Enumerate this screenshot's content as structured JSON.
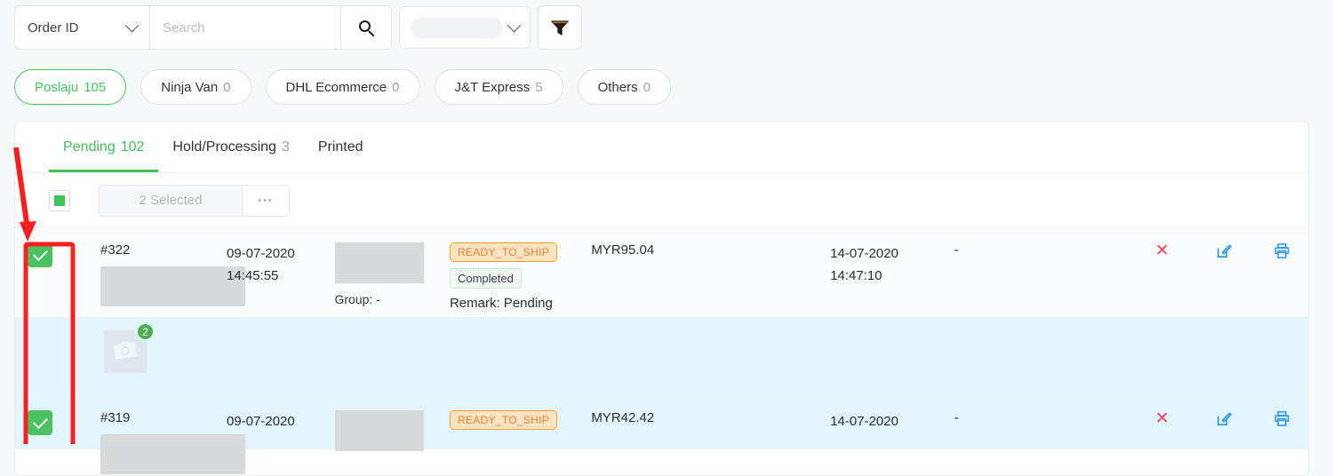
{
  "search": {
    "field_label": "Order ID",
    "placeholder": "Search",
    "value": "",
    "search_icon": "search-icon",
    "secondary_select_value": "",
    "chevron_icon": "chevron-down-icon",
    "filter_icon": "funnel-filter-icon"
  },
  "couriers": [
    {
      "label": "Poslaju",
      "count": "105",
      "active": true
    },
    {
      "label": "Ninja Van",
      "count": "0",
      "active": false
    },
    {
      "label": "DHL Ecommerce",
      "count": "0",
      "active": false
    },
    {
      "label": "J&T Express",
      "count": "5",
      "active": false
    },
    {
      "label": "Others",
      "count": "0",
      "active": false
    }
  ],
  "tabs": [
    {
      "label": "Pending",
      "count": "102",
      "active": true
    },
    {
      "label": "Hold/Processing",
      "count": "3",
      "active": false
    },
    {
      "label": "Printed",
      "count": "",
      "active": false
    }
  ],
  "toolbar": {
    "select_all_icon": "indeterminate-checkbox-icon",
    "selected_label": "2 Selected",
    "more_label": "⋯"
  },
  "rows": [
    {
      "checked": true,
      "order_id": "#322",
      "date": "09-07-2020",
      "time": "14:45:55",
      "group_label": "Group: -",
      "status_badge": "READY_TO_SHIP",
      "sub_badge": "Completed",
      "remark": "Remark: Pending",
      "amount": "MYR95.04",
      "sla_date": "14-07-2020",
      "sla_time": "14:47:10",
      "extra": "-",
      "cancel_icon": "close-x-icon",
      "edit_icon": "edit-pencil-icon",
      "print_icon": "printer-icon"
    },
    {
      "checked": true,
      "order_id": "#319",
      "date": "09-07-2020",
      "time": "",
      "group_label": "",
      "status_badge": "READY_TO_SHIP",
      "sub_badge": "",
      "remark": "",
      "amount": "MYR42.42",
      "sla_date": "14-07-2020",
      "sla_time": "",
      "extra": "-",
      "cancel_icon": "close-x-icon",
      "edit_icon": "edit-pencil-icon",
      "print_icon": "printer-icon"
    }
  ],
  "expanded_row": {
    "thumbnail_icon": "camera-placeholder-icon",
    "quantity_badge": "2"
  },
  "annotation": {
    "color": "#fa1f1f",
    "arrow_icon": "red-arrow-annotation",
    "highlight_icon": "red-rectangle-annotation"
  },
  "colors": {
    "accent_green": "#3fbf56",
    "badge_orange": "#e8812a",
    "link_blue": "#2f9bf5",
    "danger_red": "#f1415f",
    "row_highlight_blue": "#e4f4fd"
  }
}
